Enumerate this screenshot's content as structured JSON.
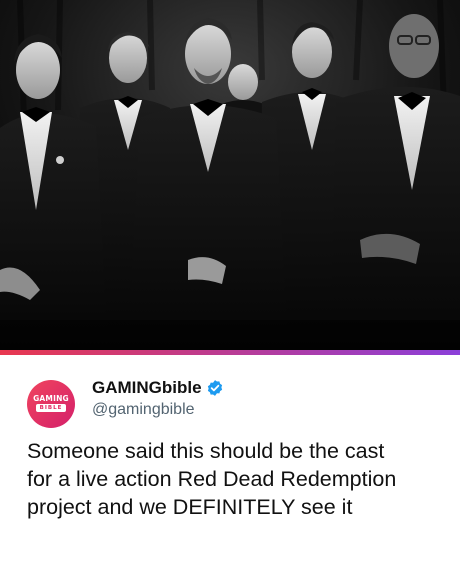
{
  "post": {
    "account": {
      "display_name": "GAMINGbible",
      "handle": "@gamingbible",
      "avatar_text_top": "GAMING",
      "avatar_text_bottom": "BIBLE",
      "verified": true,
      "verified_icon": "verified-badge-icon"
    },
    "text_lines": [
      "Someone said this should be the cast",
      "for a live action Red Dead Redemption",
      "project and we DEFINITELY see it"
    ]
  },
  "photo": {
    "subject": "group-photo"
  },
  "colors": {
    "accent_gradient_start": "#e8384f",
    "accent_gradient_end": "#8b3fd9",
    "avatar_gradient_start": "#f0445e",
    "avatar_gradient_end": "#d4206a",
    "verified_blue": "#1d9bf0",
    "handle_gray": "#536471",
    "text": "#111111"
  }
}
